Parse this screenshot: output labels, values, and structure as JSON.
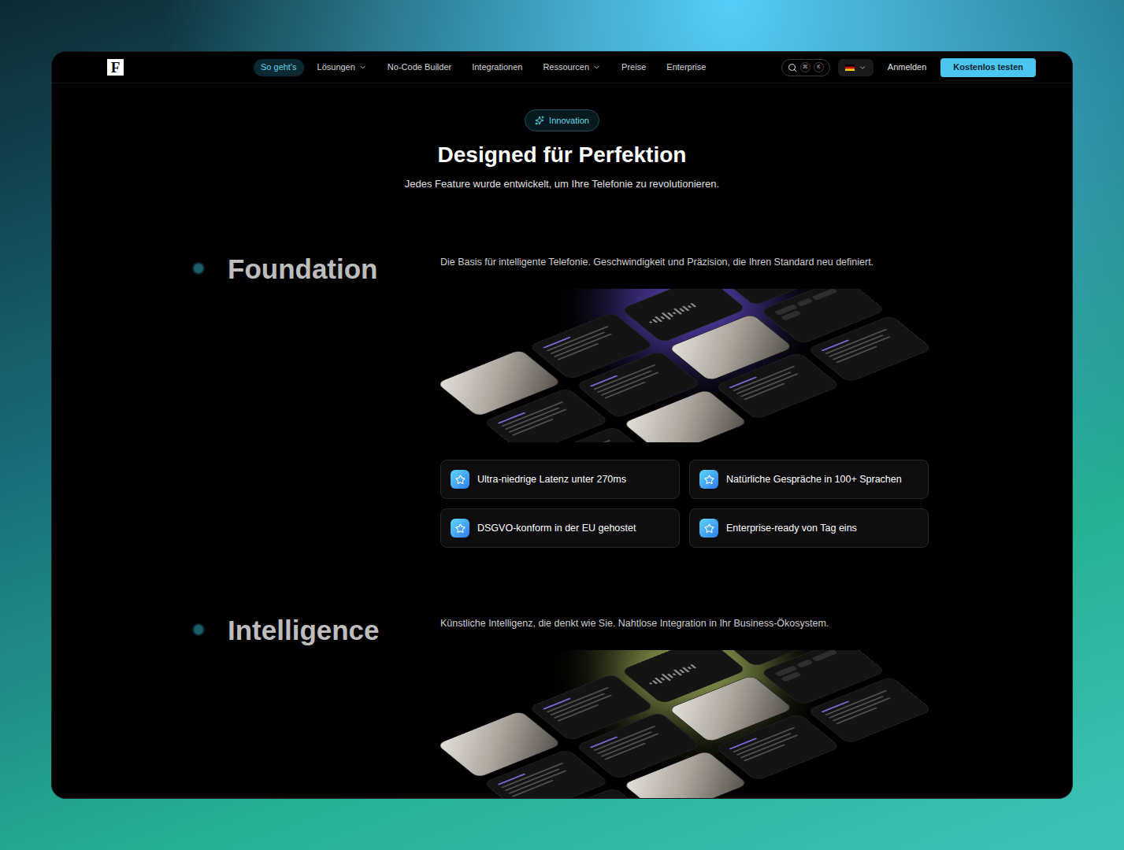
{
  "logo": "F",
  "nav": {
    "items": [
      {
        "label": "So geht's",
        "selected": true,
        "has_menu": false
      },
      {
        "label": "Lösungen",
        "selected": false,
        "has_menu": true
      },
      {
        "label": "No-Code Builder",
        "selected": false,
        "has_menu": false
      },
      {
        "label": "Integrationen",
        "selected": false,
        "has_menu": false
      },
      {
        "label": "Ressourcen",
        "selected": false,
        "has_menu": true
      },
      {
        "label": "Preise",
        "selected": false,
        "has_menu": false
      },
      {
        "label": "Enterprise",
        "selected": false,
        "has_menu": false
      }
    ],
    "search_keys": [
      "⌘",
      "K"
    ],
    "login": "Anmelden",
    "cta": "Kostenlos testen"
  },
  "hero": {
    "badge": "Innovation",
    "title": "Designed für Perfektion",
    "subtitle": "Jedes Feature wurde entwickelt, um Ihre Telefonie zu revolutionieren."
  },
  "sections": [
    {
      "title": "Foundation",
      "description": "Die Basis für intelligente Telefonie. Geschwindigkeit und Präzision, die Ihren Standard neu definiert.",
      "color": "#7c5cff",
      "features": [
        "Ultra-niedrige Latenz unter 270ms",
        "Natürliche Gespräche in 100+ Sprachen",
        "DSGVO-konform in der EU gehostet",
        "Enterprise-ready von Tag eins"
      ]
    },
    {
      "title": "Intelligence",
      "description": "Künstliche Intelligenz, die denkt wie Sie. Nahtlose Integration in Ihr Business-Ökosystem.",
      "color": "#d8f07a",
      "features": []
    }
  ]
}
